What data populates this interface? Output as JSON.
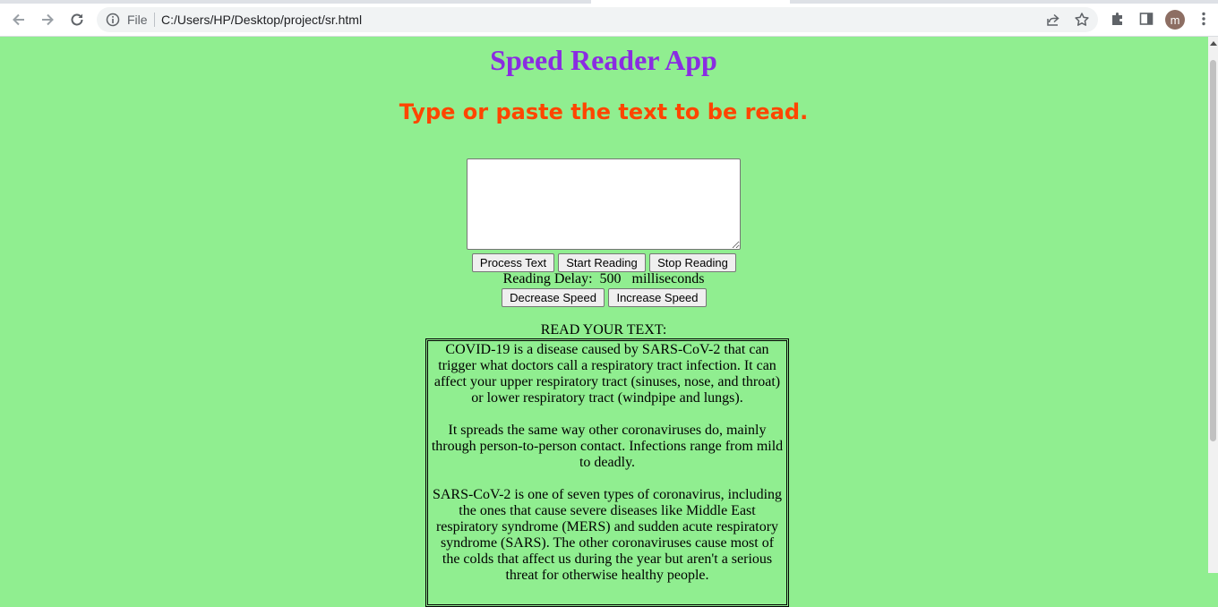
{
  "browser": {
    "scheme_label": "File",
    "url": "C:/Users/HP/Desktop/project/sr.html",
    "profile_initial": "m",
    "icons": [
      "back-icon",
      "forward-icon",
      "reload-icon",
      "info-icon",
      "share-icon",
      "star-icon",
      "extensions-icon",
      "side-panel-icon",
      "menu-icon"
    ]
  },
  "app": {
    "title": "Speed Reader App",
    "instruction": "Type or paste the text to be read.",
    "text_input_value": "",
    "buttons": {
      "process": "Process Text",
      "start": "Start Reading",
      "stop": "Stop Reading",
      "decrease": "Decrease Speed",
      "increase": "Increase Speed"
    },
    "delay": {
      "label": "Reading Delay:",
      "value": "500",
      "unit": "milliseconds"
    },
    "output_label": "READ YOUR TEXT:",
    "output_paragraphs": [
      "COVID-19 is a disease caused by SARS-CoV-2 that can trigger what doctors call a respiratory tract infection. It can affect your upper respiratory tract (sinuses, nose, and throat) or lower respiratory tract (windpipe and lungs).",
      "It spreads the same way other coronaviruses do, mainly through person-to-person contact. Infections range from mild to deadly.",
      "SARS-CoV-2 is one of seven types of coronavirus, including the ones that cause severe diseases like Middle East respiratory syndrome (MERS) and sudden acute respiratory syndrome (SARS). The other coronaviruses cause most of the colds that affect us during the year but aren't a serious threat for otherwise healthy people."
    ]
  },
  "colors": {
    "page_background": "#90ee90",
    "title": "#8a2be2",
    "instruction": "#ff4500"
  }
}
